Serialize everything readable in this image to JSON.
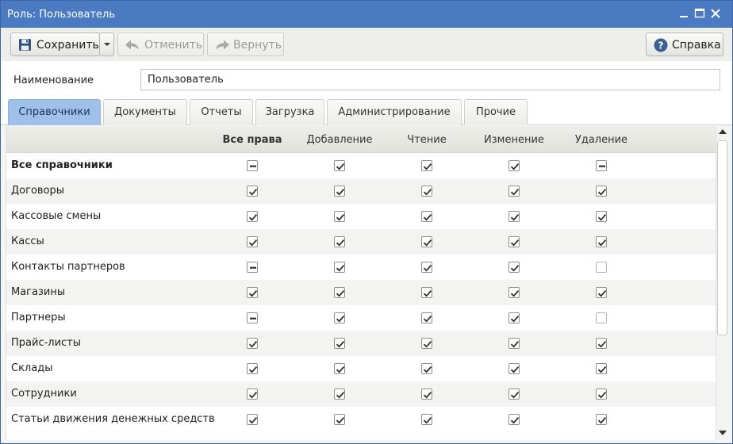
{
  "window": {
    "title": "Роль: Пользователь",
    "accent_color": "#4a7ac2"
  },
  "toolbar": {
    "save_label": "Сохранить",
    "undo_label": "Отменить",
    "redo_label": "Вернуть",
    "help_label": "Справка",
    "icons": {
      "save": "floppy-disk-icon",
      "undo": "undo-arrow-icon",
      "redo": "redo-arrow-icon",
      "help": "question-circle-icon",
      "dropdown": "chevron-down-icon"
    }
  },
  "name_field": {
    "label": "Наименование",
    "value": "Пользователь"
  },
  "tabs": [
    {
      "label": "Справочники",
      "active": true
    },
    {
      "label": "Документы",
      "active": false
    },
    {
      "label": "Отчеты",
      "active": false
    },
    {
      "label": "Загрузка",
      "active": false
    },
    {
      "label": "Администрирование",
      "active": false
    },
    {
      "label": "Прочие",
      "active": false
    }
  ],
  "grid": {
    "columns": [
      "Все права",
      "Добавление",
      "Чтение",
      "Изменение",
      "Удаление"
    ],
    "rows": [
      {
        "name": "Все справочники",
        "bold": true,
        "rights": [
          "partial",
          "checked",
          "checked",
          "checked",
          "partial"
        ]
      },
      {
        "name": "Договоры",
        "bold": false,
        "rights": [
          "checked",
          "checked",
          "checked",
          "checked",
          "checked"
        ]
      },
      {
        "name": "Кассовые смены",
        "bold": false,
        "rights": [
          "checked",
          "checked",
          "checked",
          "checked",
          "checked"
        ]
      },
      {
        "name": "Кассы",
        "bold": false,
        "rights": [
          "checked",
          "checked",
          "checked",
          "checked",
          "checked"
        ]
      },
      {
        "name": "Контакты партнеров",
        "bold": false,
        "rights": [
          "partial",
          "checked",
          "checked",
          "checked",
          "unchecked"
        ]
      },
      {
        "name": "Магазины",
        "bold": false,
        "rights": [
          "checked",
          "checked",
          "checked",
          "checked",
          "checked"
        ]
      },
      {
        "name": "Партнеры",
        "bold": false,
        "rights": [
          "partial",
          "checked",
          "checked",
          "checked",
          "unchecked"
        ]
      },
      {
        "name": "Прайс-листы",
        "bold": false,
        "rights": [
          "checked",
          "checked",
          "checked",
          "checked",
          "checked"
        ]
      },
      {
        "name": "Склады",
        "bold": false,
        "rights": [
          "checked",
          "checked",
          "checked",
          "checked",
          "checked"
        ]
      },
      {
        "name": "Сотрудники",
        "bold": false,
        "rights": [
          "checked",
          "checked",
          "checked",
          "checked",
          "checked"
        ]
      },
      {
        "name": "Статьи движения денежных средств",
        "bold": false,
        "rights": [
          "checked",
          "checked",
          "checked",
          "checked",
          "checked"
        ]
      }
    ]
  }
}
